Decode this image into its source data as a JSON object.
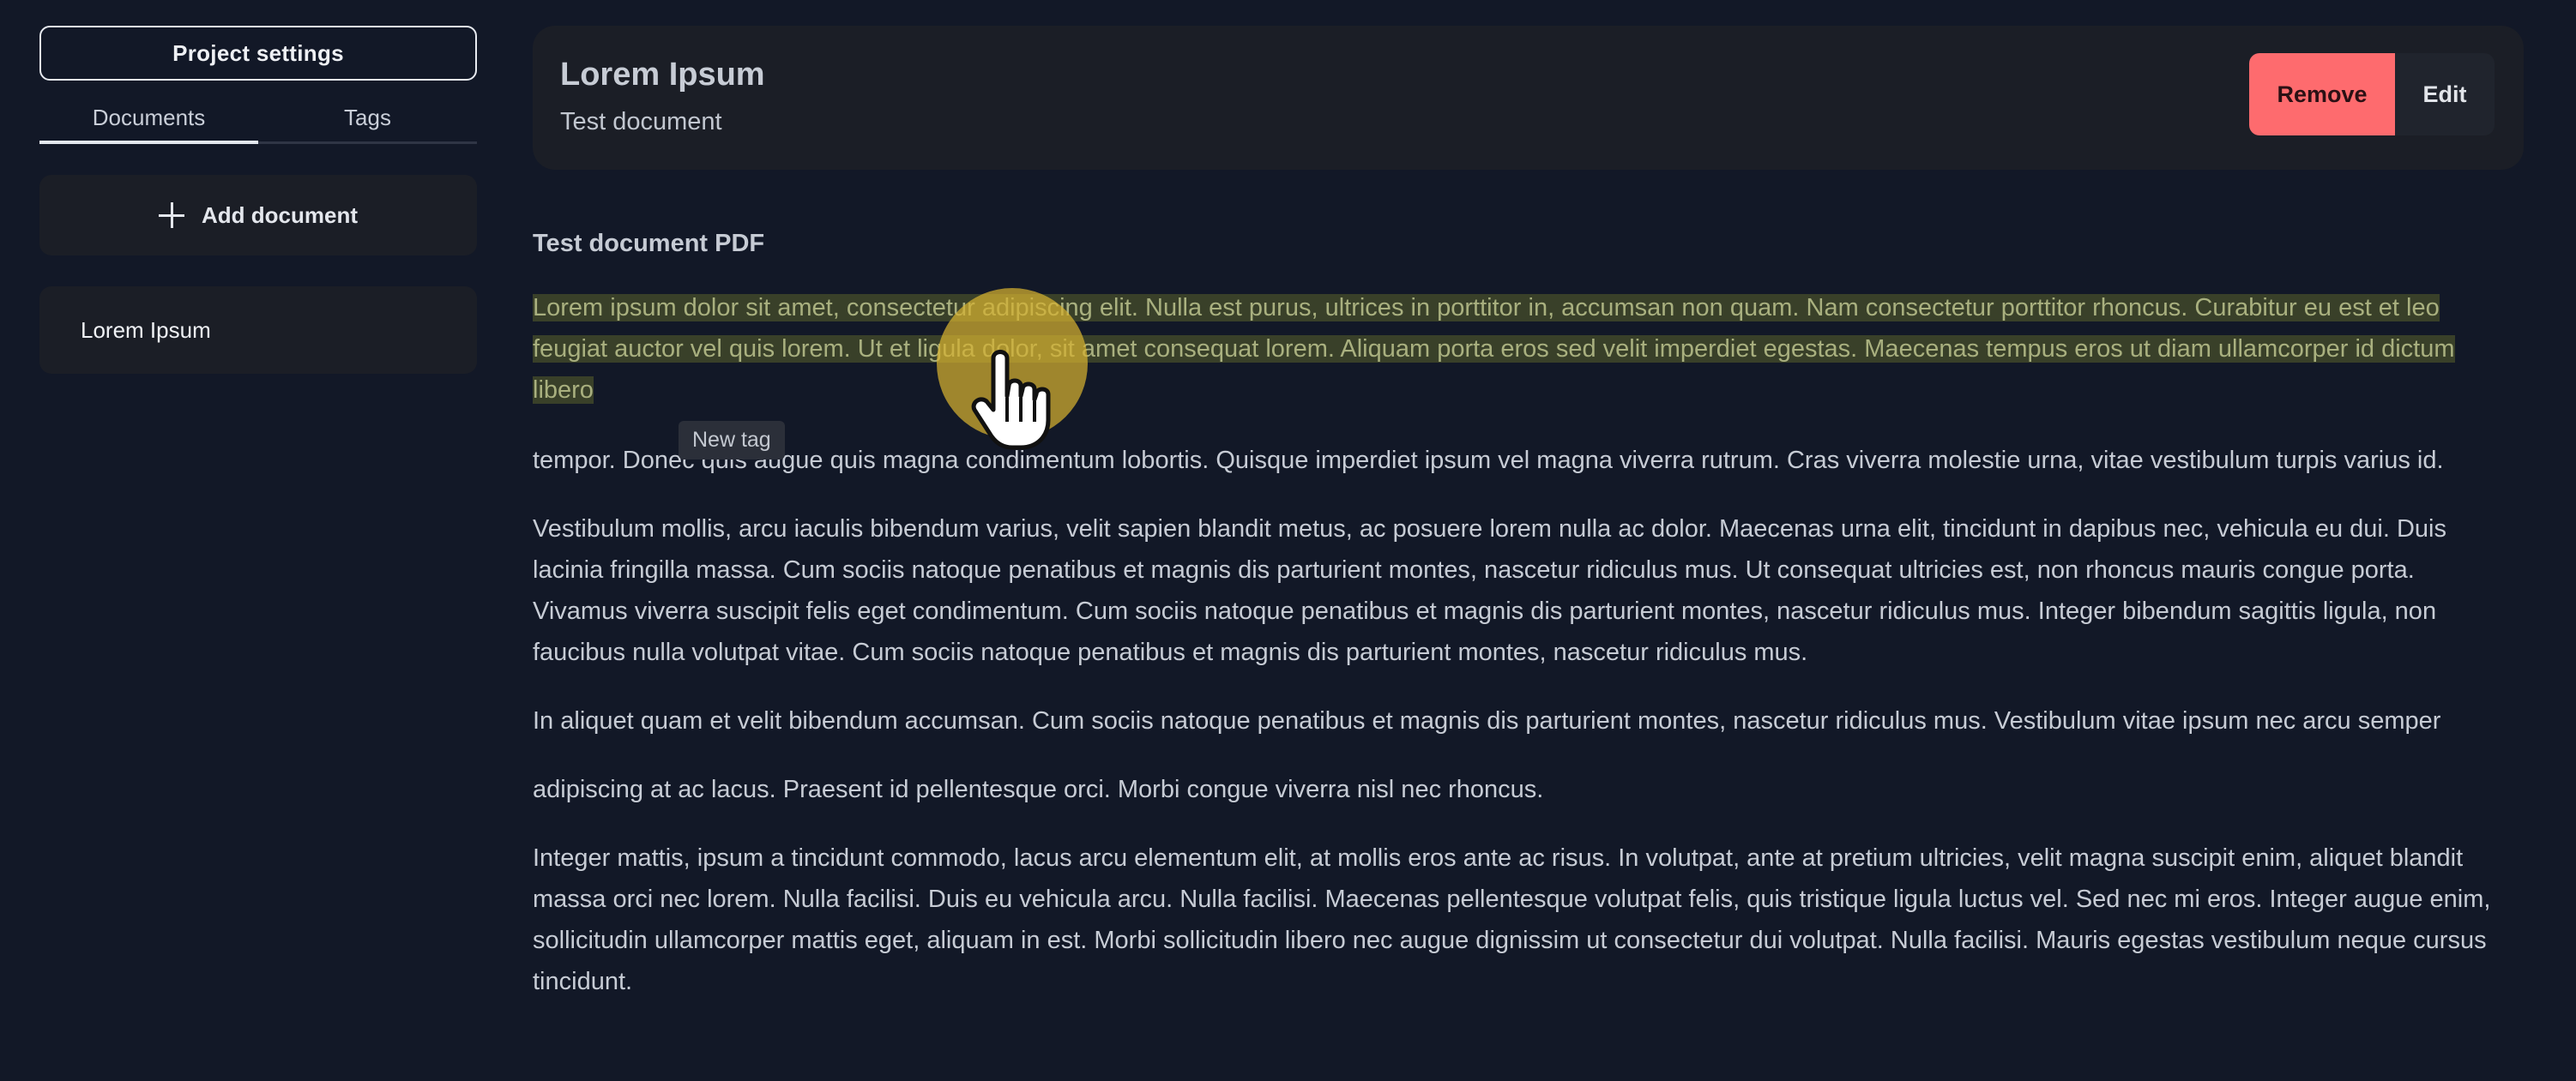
{
  "sidebar": {
    "settings_label": "Project settings",
    "tabs": [
      {
        "label": "Documents",
        "active": true
      },
      {
        "label": "Tags",
        "active": false
      }
    ],
    "add_document_label": "Add document",
    "documents": [
      {
        "label": "Lorem Ipsum"
      }
    ]
  },
  "header": {
    "title": "Lorem Ipsum",
    "subtitle": "Test document",
    "remove_label": "Remove",
    "edit_label": "Edit"
  },
  "content": {
    "section_title": "Test document PDF",
    "highlighted_paragraph": "Lorem ipsum dolor sit amet, consectetur adipiscing elit. Nulla est purus, ultrices in porttitor in, accumsan non quam. Nam consectetur porttitor rhoncus. Curabitur eu est et leo feugiat auctor vel quis lorem. Ut et ligula dolor, sit amet consequat lorem. Aliquam porta eros sed velit imperdiet egestas. Maecenas tempus eros ut diam ullamcorper id dictum libero",
    "tooltip": "New tag",
    "paragraphs": [
      "tempor. Donec quis augue quis magna condimentum lobortis. Quisque imperdiet ipsum vel magna viverra rutrum. Cras viverra molestie urna, vitae vestibulum turpis varius id.",
      "Vestibulum mollis, arcu iaculis bibendum varius, velit sapien blandit metus, ac posuere lorem nulla ac dolor. Maecenas urna elit, tincidunt in dapibus nec, vehicula eu dui. Duis lacinia fringilla massa. Cum sociis natoque penatibus et magnis dis parturient montes, nascetur ridiculus mus. Ut consequat ultricies est, non rhoncus mauris congue porta. Vivamus viverra suscipit felis eget condimentum. Cum sociis natoque penatibus et magnis dis parturient montes, nascetur ridiculus mus. Integer bibendum sagittis ligula, non faucibus nulla volutpat vitae. Cum sociis natoque penatibus et magnis dis parturient montes, nascetur ridiculus mus.",
      "In aliquet quam et velit bibendum accumsan. Cum sociis natoque penatibus et magnis dis parturient montes, nascetur ridiculus mus. Vestibulum vitae ipsum nec arcu semper",
      "adipiscing at ac lacus. Praesent id pellentesque orci. Morbi congue viverra nisl nec rhoncus.",
      "Integer mattis, ipsum a tincidunt commodo, lacus arcu elementum elit, at mollis eros ante ac risus. In volutpat, ante at pretium ultricies, velit magna suscipit enim, aliquet blandit massa orci nec lorem. Nulla facilisi. Duis eu vehicula arcu. Nulla facilisi. Maecenas pellentesque volutpat felis, quis tristique ligula luctus vel. Sed nec mi eros. Integer augue enim, sollicitudin ullamcorper mattis eget, aliquam in est. Morbi sollicitudin libero nec augue dignissim ut consectetur dui volutpat. Nulla facilisi. Mauris egestas vestibulum neque cursus tincidunt."
    ]
  },
  "colors": {
    "background": "#121827",
    "card": "#1b1e26",
    "remove_accent": "#fe6b6e",
    "highlight": "#394029",
    "cursor_ring": "#d6b230"
  },
  "icons": {
    "add": "plus-icon",
    "cursor": "hand-pointer-icon"
  }
}
